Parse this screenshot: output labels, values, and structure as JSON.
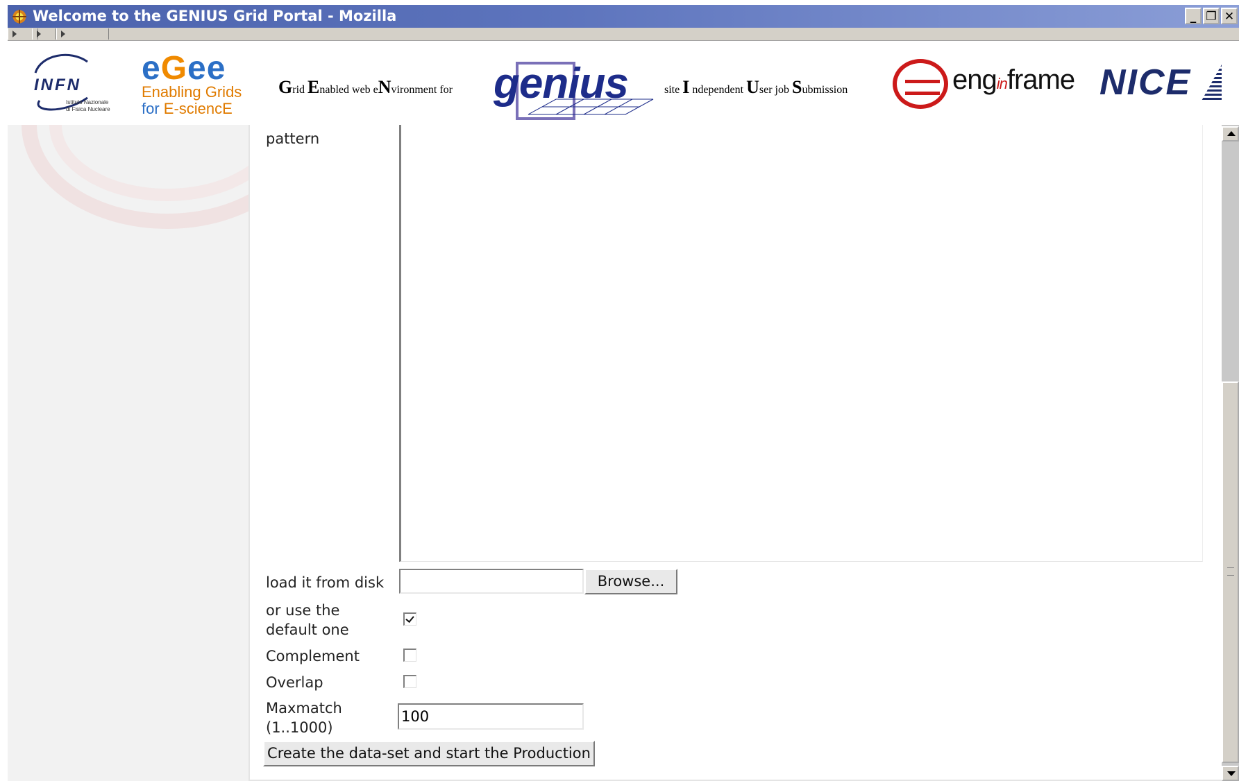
{
  "window": {
    "title": "Welcome to the GENIUS Grid Portal - Mozilla",
    "controls": {
      "minimize": "_",
      "restore": "❐",
      "close": "✕"
    }
  },
  "banner": {
    "infn": {
      "name": "INFN",
      "subtitle_line1": "Istituto Nazionale",
      "subtitle_line2": "di Fisica Nucleare"
    },
    "egee": {
      "name_part1": "e",
      "name_part2": "G",
      "name_part3": "ee",
      "line1": "Enabling Grids",
      "line2_prefix": "for ",
      "line2_suffix": "E-sciencE"
    },
    "genius_left": {
      "G": "G",
      "g_rest": "rid ",
      "E": "E",
      "e_rest": "nabled web e",
      "N": "N",
      "n_rest": "vironment for"
    },
    "genius_logo": "genius",
    "genius_right": {
      "pre": "site ",
      "I": "I",
      "i_rest": " ndependent ",
      "U": "U",
      "u_rest": "ser job ",
      "S": "S",
      "s_rest": "ubmission"
    },
    "enginframe": {
      "part1": "eng",
      "part2": "in",
      "part3": "frame"
    },
    "nice": "NICE"
  },
  "form": {
    "pattern_label": "pattern",
    "load_label": "load it from disk",
    "browse_button": "Browse...",
    "default_label_line1": "or use the",
    "default_label_line2": "default one",
    "default_checked": true,
    "complement_label": "Complement",
    "complement_checked": false,
    "overlap_label": "Overlap",
    "overlap_checked": false,
    "maxmatch_label_line1": "Maxmatch",
    "maxmatch_label_line2": "(1..1000)",
    "maxmatch_value": "100",
    "submit_button": "Create the data-set and start the Production"
  },
  "colors": {
    "titlebar_start": "#4b62ac",
    "titlebar_end": "#8b9ed7",
    "enginframe_red": "#cc1a1a",
    "egee_blue": "#2b6fc6",
    "egee_orange": "#e07b00"
  }
}
